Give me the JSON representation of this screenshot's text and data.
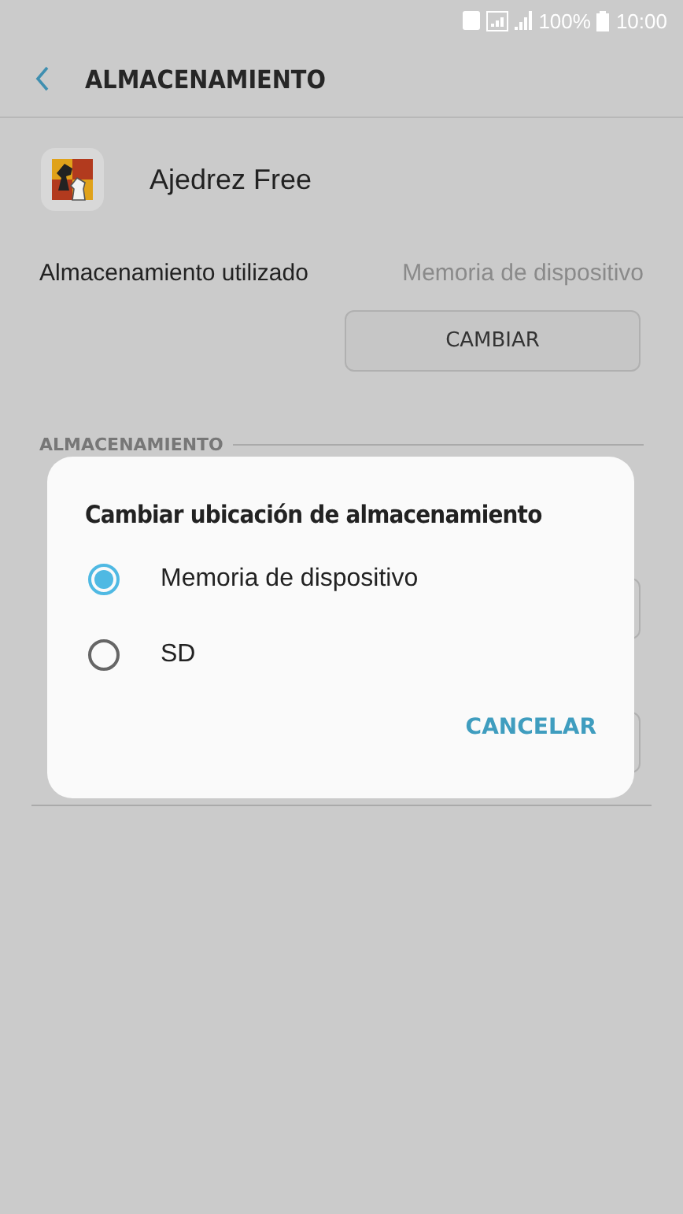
{
  "status_bar": {
    "battery": "100%",
    "time": "10:00"
  },
  "header": {
    "title": "ALMACENAMIENTO"
  },
  "app": {
    "name": "Ajedrez Free"
  },
  "storage_used": {
    "label": "Almacenamiento utilizado",
    "value": "Memoria de dispositivo",
    "button": "CAMBIAR"
  },
  "section": {
    "title": "ALMACENAMIENTO"
  },
  "dialog": {
    "title": "Cambiar ubicación de almacenamiento",
    "options": [
      {
        "label": "Memoria de dispositivo",
        "selected": true
      },
      {
        "label": "SD",
        "selected": false
      }
    ],
    "button": "CANCELAR"
  }
}
